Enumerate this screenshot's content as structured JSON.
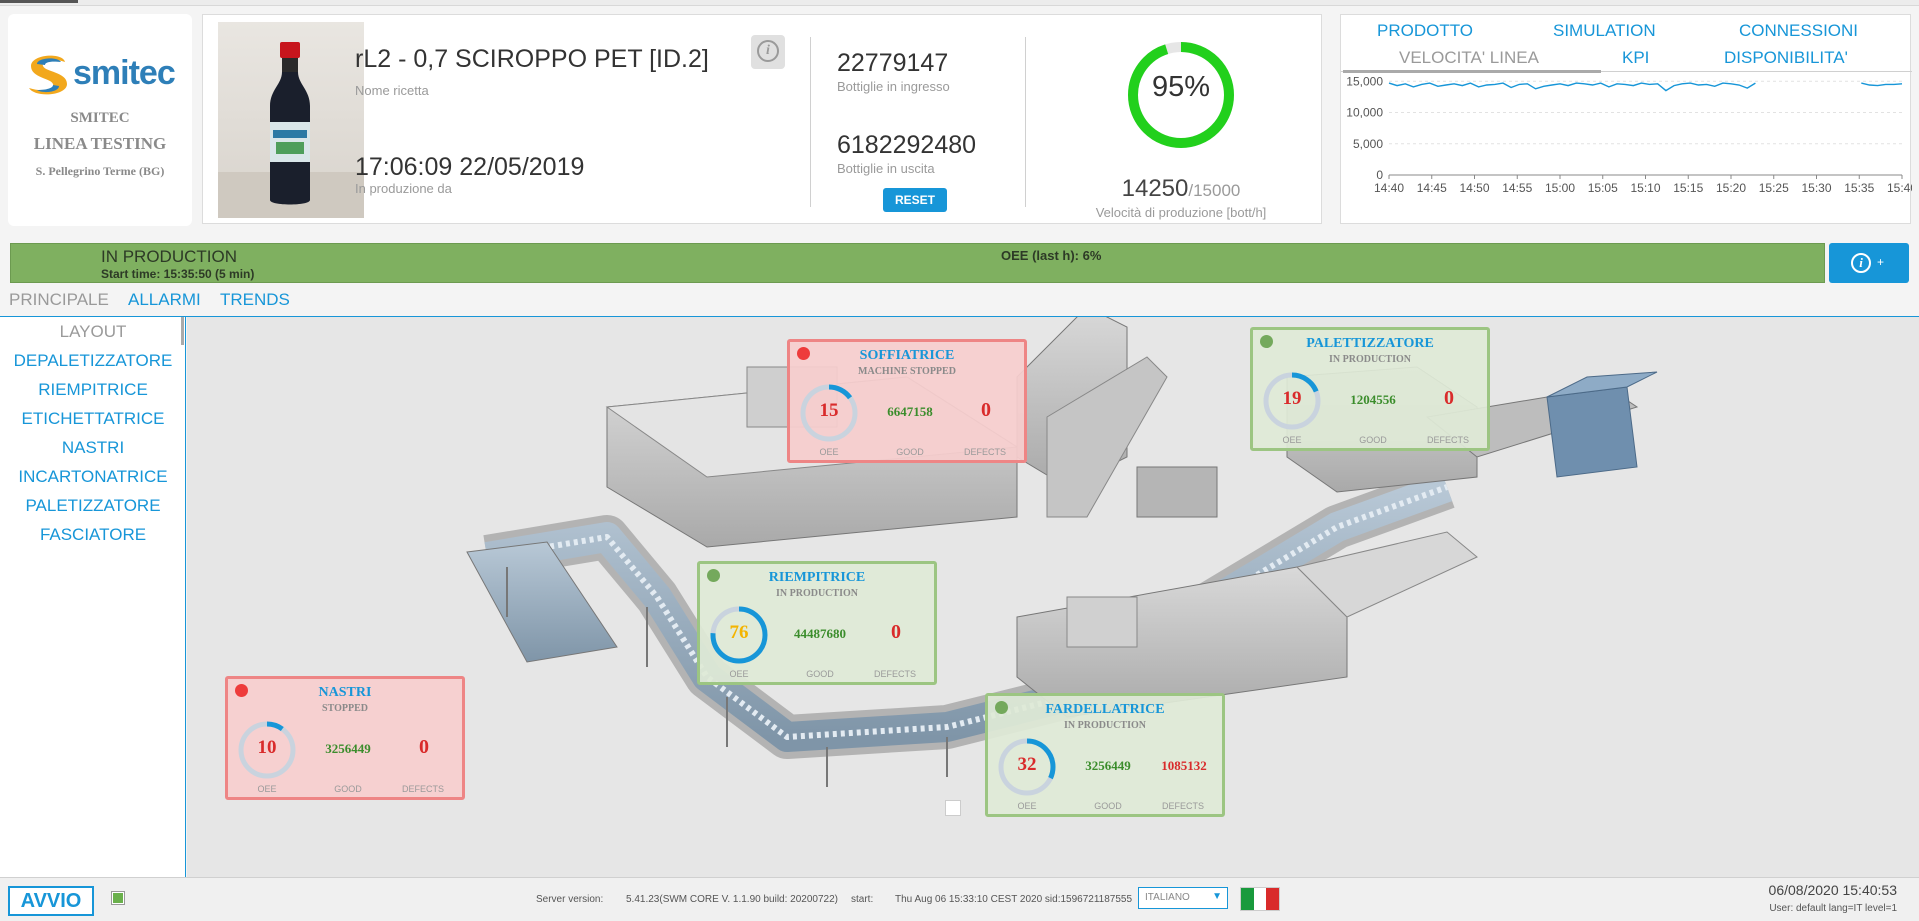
{
  "company": {
    "brand": "smitec",
    "name": "SMITEC",
    "line": "LINEA TESTING",
    "location": "S. Pellegrino Terme (BG)"
  },
  "recipe": {
    "name": "rL2 - 0,7 SCIROPPO PET [ID.2]",
    "name_label": "Nome ricetta",
    "start": "17:06:09 22/05/2019",
    "start_label": "In produzione da",
    "bottles_in": "22779147",
    "bottles_in_label": "Bottiglie in ingresso",
    "bottles_out": "6182292480",
    "bottles_out_label": "Bottiglie in uscita",
    "reset_label": "RESET",
    "efficiency_text": "95%",
    "efficiency": 0.95,
    "speed": "14250",
    "speed_target": "/15000",
    "speed_label": "Velocità di produzione [bott/h]"
  },
  "right_tabs": {
    "row1": [
      "PRODOTTO",
      "SIMULATION",
      "CONNESSIONI"
    ],
    "row2": [
      "VELOCITA' LINEA",
      "KPI",
      "DISPONIBILITA'"
    ]
  },
  "chart_data": {
    "type": "line",
    "title": "",
    "xlabel": "",
    "ylabel": "",
    "ylim": [
      0,
      16000
    ],
    "yticks": [
      "15,000",
      "10,000",
      "5,000",
      "0"
    ],
    "ytick_values": [
      15000,
      10000,
      5000,
      0
    ],
    "xticks": [
      "14:40",
      "14:45",
      "14:50",
      "14:55",
      "15:00",
      "15:05",
      "15:10",
      "15:15",
      "15:20",
      "15:25",
      "15:30",
      "15:35",
      "15:40"
    ],
    "grid": true,
    "series": [
      {
        "values": [
          14700,
          14300,
          14600,
          14100,
          14500,
          14700,
          14200,
          14400,
          14600,
          14300,
          14700,
          14100,
          14400,
          14500,
          14700,
          14000,
          14500,
          14600,
          13800,
          14200,
          14400,
          14600,
          14300,
          14700,
          14600,
          14400,
          14700,
          14100,
          14600,
          14500,
          14300,
          14700,
          14500,
          14600,
          13500,
          14300,
          14600,
          14700,
          14400,
          14500,
          14200,
          14700,
          14600,
          14400,
          13900,
          14700,
          null,
          null,
          null,
          null,
          null,
          null,
          null,
          null,
          null,
          null,
          null,
          null,
          14700,
          14400,
          14300,
          14500,
          14500,
          14600
        ]
      }
    ]
  },
  "status": {
    "state": "IN PRODUCTION",
    "start_time": "Start time: 15:35:50 (5 min)",
    "oee": "OEE (last h): 6%",
    "color": "#7fb060"
  },
  "main_tabs": [
    "PRINCIPALE",
    "ALLARMI",
    "TRENDS"
  ],
  "nav": [
    "LAYOUT",
    "DEPALETIZZATORE",
    "RIEMPITRICE",
    "ETICHETTATRICE",
    "NASTRI",
    "INCARTONATRICE",
    "PALETIZZATORE",
    "FASCIATORE"
  ],
  "labels": {
    "oee": "OEE",
    "good": "GOOD",
    "defects": "DEFECTS"
  },
  "machines": [
    {
      "name": "SOFFIATRICE",
      "state": "MACHINE STOPPED",
      "oee": "15",
      "oee_level": 0.15,
      "good": "6647158",
      "defects": "0"
    },
    {
      "name": "PALETTIZZATORE",
      "state": "IN PRODUCTION",
      "oee": "19",
      "oee_level": 0.19,
      "good": "1204556",
      "defects": "0"
    },
    {
      "name": "RIEMPITRICE",
      "state": "IN PRODUCTION",
      "oee": "76",
      "oee_level": 0.76,
      "good": "44487680",
      "defects": "0"
    },
    {
      "name": "NASTRI",
      "state": "STOPPED",
      "oee": "10",
      "oee_level": 0.1,
      "good": "3256449",
      "defects": "0"
    },
    {
      "name": "FARDELLATRICE",
      "state": "IN PRODUCTION",
      "oee": "32",
      "oee_level": 0.32,
      "good": "3256449",
      "defects": "1085132"
    }
  ],
  "footer": {
    "start_button": "AVVIO",
    "server_label": "Server version:",
    "server_version": "5.41.23(SWM CORE V. 1.1.90 build: 20200722)",
    "start_label": "start:",
    "start_value": "Thu Aug 06 15:33:10 CEST 2020 sid:1596721187555",
    "language": "ITALIANO",
    "datetime": "06/08/2020  15:40:53",
    "user": "User: default lang=IT level=1"
  },
  "colors": {
    "accent": "#1796d8",
    "ok": "#74a95c",
    "alarm": "#ee3b3b"
  }
}
